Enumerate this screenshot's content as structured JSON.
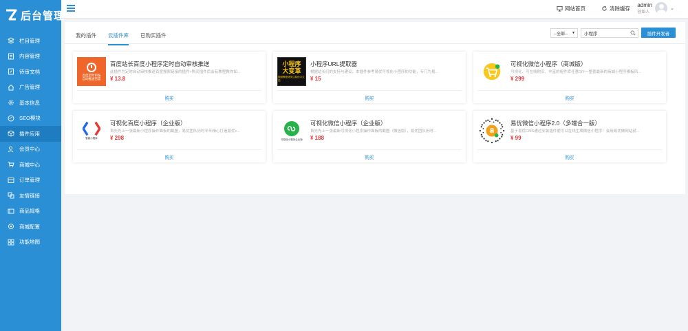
{
  "app": {
    "logo_text": "后台管理"
  },
  "colors": {
    "sidebar": "#2a8fd4",
    "accent": "#2a8fd4",
    "price": "#e4393c"
  },
  "sidebar": {
    "items": [
      {
        "label": "栏目管理",
        "icon": "layers-icon"
      },
      {
        "label": "内容管理",
        "icon": "document-icon"
      },
      {
        "label": "待审文档",
        "icon": "edit-doc-icon"
      },
      {
        "label": "广告管理",
        "icon": "home-icon"
      },
      {
        "label": "基本信息",
        "icon": "gear-icon"
      },
      {
        "label": "SEO模块",
        "icon": "globe-icon"
      },
      {
        "label": "插件应用",
        "icon": "cube-icon",
        "active": true
      },
      {
        "label": "会员中心",
        "icon": "user-icon"
      },
      {
        "label": "商城中心",
        "icon": "cart-icon"
      },
      {
        "label": "订单管理",
        "icon": "order-icon"
      },
      {
        "label": "友情链接",
        "icon": "link-icon"
      },
      {
        "label": "商品规格",
        "icon": "spec-icon"
      },
      {
        "label": "商城配置",
        "icon": "settings-icon"
      },
      {
        "label": "功能地图",
        "icon": "grid-icon"
      }
    ]
  },
  "topbar": {
    "site_home": "网站首页",
    "clear_cache": "清除缓存",
    "username": "admin",
    "role": "创始人"
  },
  "tabs": [
    {
      "label": "我的插件",
      "active": false
    },
    {
      "label": "云插件库",
      "active": true
    },
    {
      "label": "已购买插件",
      "active": false
    }
  ],
  "search": {
    "filter_selected": "--全部--",
    "query": "小程序",
    "developer_button": "插件开发者"
  },
  "cards": [
    {
      "title": "百度站长百度小程序定时自动审核推送",
      "desc": "此插件为定时自动审核推送百度搜索链接的插件+购买插件后会有教程教你如...",
      "price": "¥ 13.8",
      "buy": "购买",
      "thumb_lines": [
        "百度定时审核",
        "自动推送百度"
      ]
    },
    {
      "title": "小程序URL提取器",
      "desc": "根据站长们的支持与建议，本插件参考易优可视化小程序的功能，专门为易...",
      "price": "¥ 15",
      "buy": "购买",
      "thumb_big1": "小程序",
      "thumb_big2": "大变革",
      "thumb_small": "视频教程请关注易优中文站"
    },
    {
      "title": "可视化微信小程序（商城版）",
      "desc": "可视化、可在线购买、丰富的组件库任意DIY一整套最新的商城小程序模板风...",
      "price": "¥ 299",
      "buy": "购买"
    },
    {
      "title": "可视化百度小程序（企业版）",
      "desc": "首先先上一张最新小程序操作面板的截图，易优团队历时半年精心打造易优c...",
      "price": "¥ 298",
      "buy": "购买",
      "thumb_caption": "智能小程序"
    },
    {
      "title": "可视化微信小程序（企业版）",
      "desc": "首先先上一张最新可视化小程序操作面板的截图（微信版），易优团队历时...",
      "price": "¥ 188",
      "buy": "购买",
      "thumb_caption": "可视化小程序企业版"
    },
    {
      "title": "易优微信小程序2.0（多端合一版）",
      "desc": "基于易优CMS通过安装插件便可以在线生成微信小程序！会用易优做网站就...",
      "price": "¥ 99",
      "buy": "购买",
      "thumb_badge": "易"
    }
  ]
}
